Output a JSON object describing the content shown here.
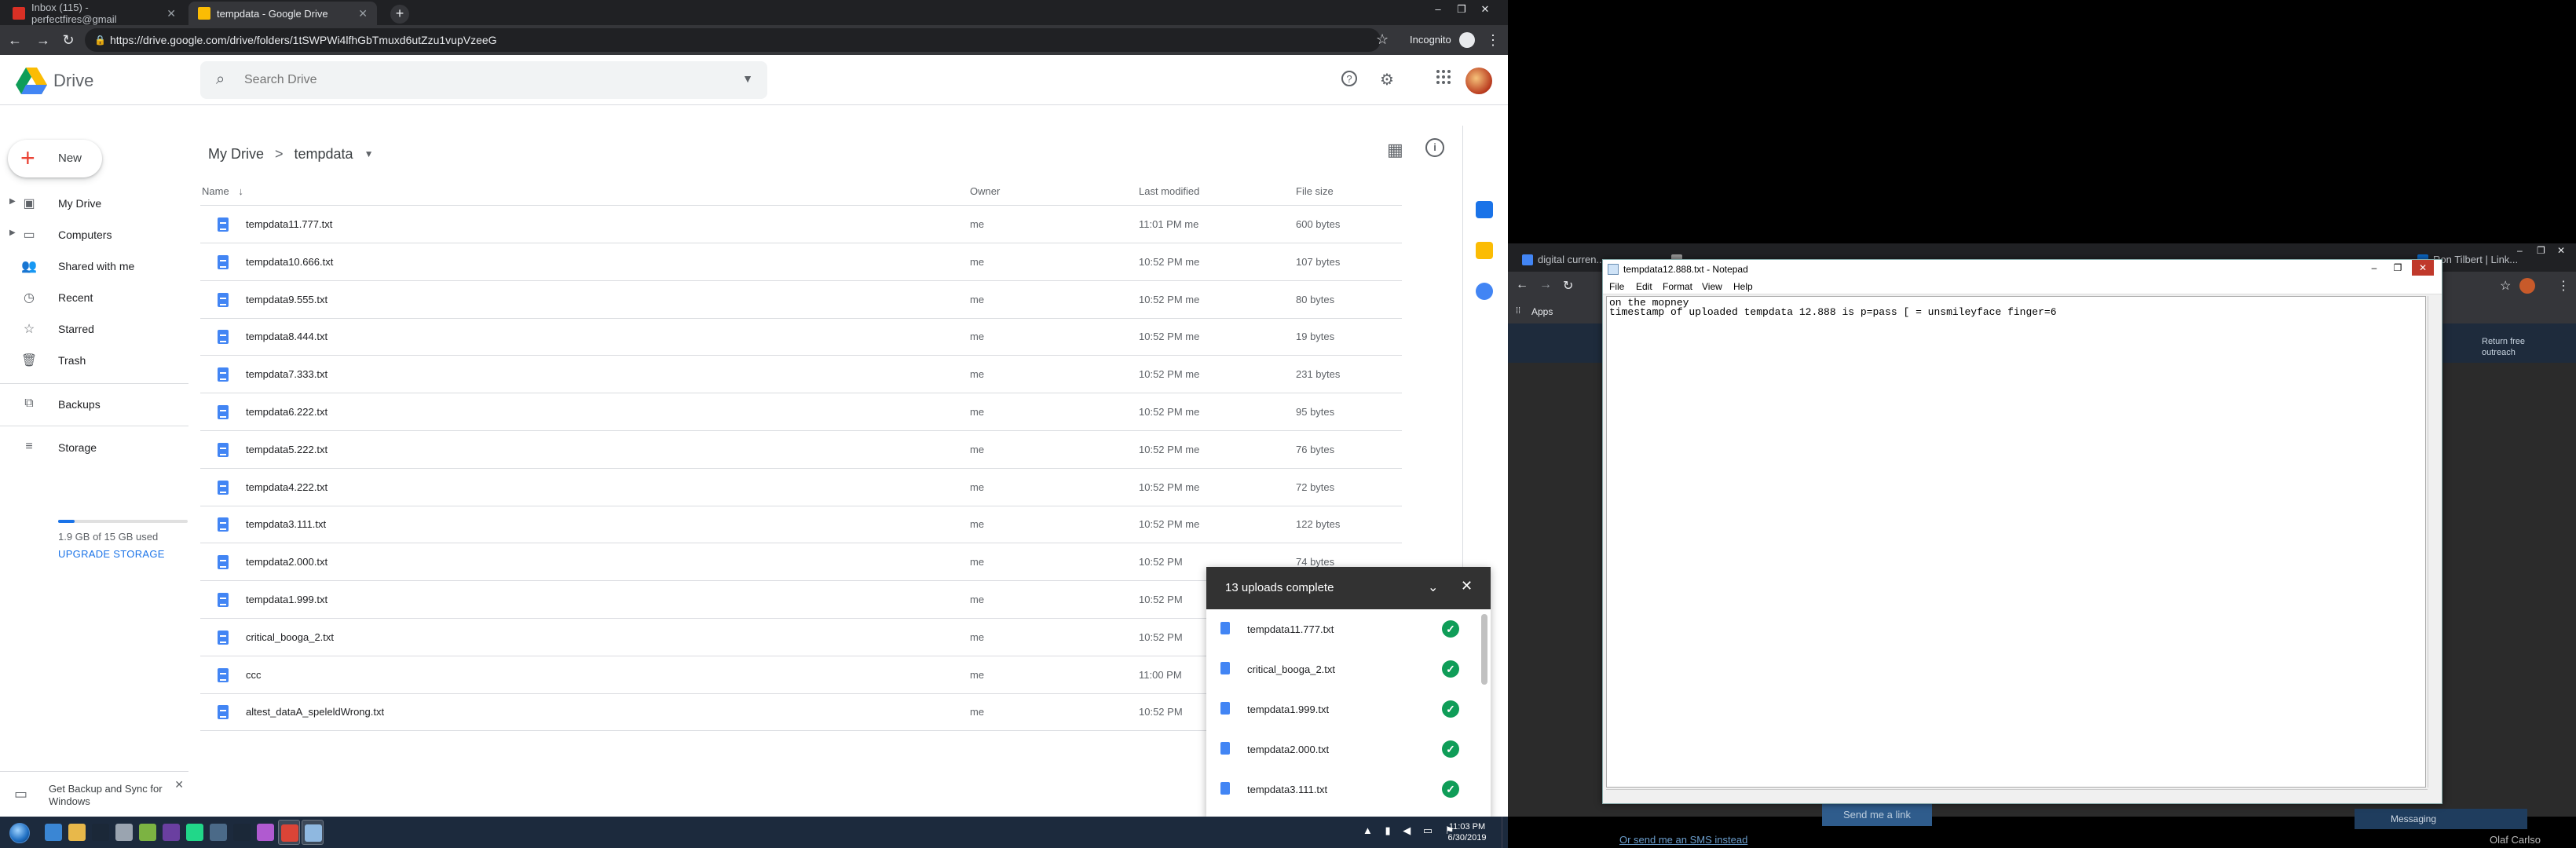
{
  "browser_left": {
    "tabs": [
      {
        "label": "Inbox (115) - perfectfires@gmail",
        "favicon_color": "#d93025"
      },
      {
        "label": "tempdata - Google Drive",
        "favicon_color": "#fbbc04"
      }
    ],
    "new_tab_glyph": "+",
    "url": "https://drive.google.com/drive/folders/1tSWPWi4lfhGbTmuxd6utZzu1vupVzeeG",
    "incognito_label": "Incognito",
    "window_controls": [
      "–",
      "❐",
      "✕"
    ]
  },
  "drive": {
    "app_title": "Drive",
    "search": {
      "placeholder": "Search Drive",
      "value": ""
    },
    "new_button_label": "New",
    "sidebar": [
      {
        "label": "My Drive",
        "icon": "my-drive-icon",
        "has_caret": true
      },
      {
        "label": "Computers",
        "icon": "computers-icon",
        "has_caret": true
      },
      {
        "label": "Shared with me",
        "icon": "shared-icon",
        "has_caret": false
      },
      {
        "label": "Recent",
        "icon": "recent-icon",
        "has_caret": false
      },
      {
        "label": "Starred",
        "icon": "star-icon",
        "has_caret": false
      },
      {
        "label": "Trash",
        "icon": "trash-icon",
        "has_caret": false
      },
      {
        "label": "Backups",
        "icon": "backups-icon",
        "has_caret": false
      },
      {
        "label": "Storage",
        "icon": "storage-icon",
        "has_caret": false
      }
    ],
    "storage": {
      "used_text": "1.9 GB of 15 GB used",
      "used_fraction": 0.127,
      "upgrade_label": "UPGRADE STORAGE"
    },
    "backup_promo": "Get Backup and Sync for Windows",
    "breadcrumb": {
      "root": "My Drive",
      "separator": ">",
      "current": "tempdata"
    },
    "columns": {
      "name": "Name",
      "owner": "Owner",
      "last_modified": "Last modified",
      "file_size": "File size",
      "sort_arrow": "↓"
    },
    "files": [
      {
        "name": "tempdata11.777.txt",
        "owner": "me",
        "modified": "11:01 PM me",
        "size": "600 bytes"
      },
      {
        "name": "tempdata10.666.txt",
        "owner": "me",
        "modified": "10:52 PM me",
        "size": "107 bytes"
      },
      {
        "name": "tempdata9.555.txt",
        "owner": "me",
        "modified": "10:52 PM me",
        "size": "80 bytes"
      },
      {
        "name": "tempdata8.444.txt",
        "owner": "me",
        "modified": "10:52 PM me",
        "size": "19 bytes"
      },
      {
        "name": "tempdata7.333.txt",
        "owner": "me",
        "modified": "10:52 PM me",
        "size": "231 bytes"
      },
      {
        "name": "tempdata6.222.txt",
        "owner": "me",
        "modified": "10:52 PM me",
        "size": "95 bytes"
      },
      {
        "name": "tempdata5.222.txt",
        "owner": "me",
        "modified": "10:52 PM me",
        "size": "76 bytes"
      },
      {
        "name": "tempdata4.222.txt",
        "owner": "me",
        "modified": "10:52 PM me",
        "size": "72 bytes"
      },
      {
        "name": "tempdata3.111.txt",
        "owner": "me",
        "modified": "10:52 PM me",
        "size": "122 bytes"
      },
      {
        "name": "tempdata2.000.txt",
        "owner": "me",
        "modified": "10:52 PM",
        "size": "74 bytes"
      },
      {
        "name": "tempdata1.999.txt",
        "owner": "me",
        "modified": "10:52 PM",
        "size": ""
      },
      {
        "name": "critical_booga_2.txt",
        "owner": "me",
        "modified": "10:52 PM",
        "size": ""
      },
      {
        "name": "ccc",
        "owner": "me",
        "modified": "11:00 PM",
        "size": ""
      },
      {
        "name": "altest_dataA_speleldWrong.txt",
        "owner": "me",
        "modified": "10:52 PM",
        "size": ""
      }
    ],
    "upload_panel": {
      "title": "13 uploads complete",
      "minimize_glyph": "⌄",
      "close_glyph": "✕",
      "items": [
        {
          "name": "tempdata11.777.txt"
        },
        {
          "name": "critical_booga_2.txt"
        },
        {
          "name": "tempdata1.999.txt"
        },
        {
          "name": "tempdata2.000.txt"
        },
        {
          "name": "tempdata3.111.txt"
        }
      ],
      "check_glyph": "✓"
    }
  },
  "right_monitor": {
    "tabs": [
      "digital curren...",
      "...",
      "Ron Tilbert | Link..."
    ],
    "bookmarks_label": "Apps",
    "navy_text": "Return free outreach",
    "send_button": "Send me a link",
    "sms_link": "Or send me an SMS instead",
    "person": "Olaf Carlso",
    "messaging": "Messaging"
  },
  "notepad": {
    "title": "tempdata12.888.txt - Notepad",
    "menu": [
      "File",
      "Edit",
      "Format",
      "View",
      "Help"
    ],
    "lines": [
      "on the mopney",
      "timestamp of uploaded tempdata 12.888 is p=pass [ = unsmileyface finger=6"
    ],
    "controls": [
      "–",
      "❐",
      "✕"
    ]
  },
  "taskbar": {
    "clock_time": "11:03 PM",
    "clock_date": "6/30/2019",
    "tray_glyphs": "▲ ▮ ◀ ▭ ⚑",
    "apps": [
      {
        "name": "ie",
        "color": "#3a86d4"
      },
      {
        "name": "explorer",
        "color": "#e8b84a"
      },
      {
        "name": "steam",
        "color": "#1b2838"
      },
      {
        "name": "recorder",
        "color": "#9aa4b0"
      },
      {
        "name": "notepadpp",
        "color": "#7cb342"
      },
      {
        "name": "obs",
        "color": "#6a3fa0"
      },
      {
        "name": "pycharm",
        "color": "#21d789"
      },
      {
        "name": "task",
        "color": "#4b6a88"
      },
      {
        "name": "steam2",
        "color": "#1b2838"
      },
      {
        "name": "winrar",
        "color": "#b05ad0"
      },
      {
        "name": "chrome",
        "color": "#db4437"
      },
      {
        "name": "notepad",
        "color": "#8fb8e0"
      }
    ]
  }
}
